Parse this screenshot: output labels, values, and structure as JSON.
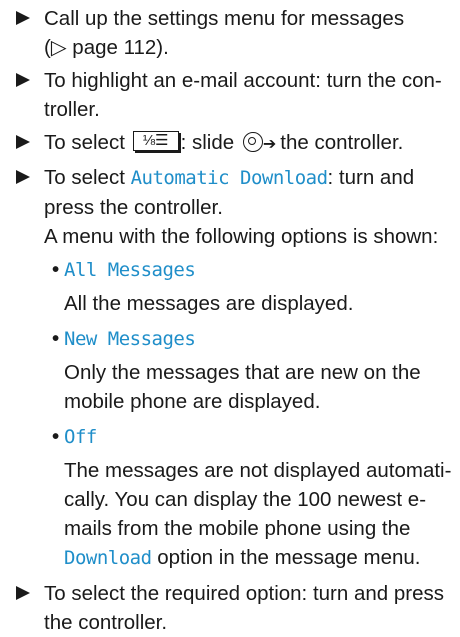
{
  "steps": {
    "s1_line1": "Call up the settings menu for messages",
    "s1_pageref": "(▷ page 112).",
    "s2_text": "To highlight an e-mail account: turn the con-troller.",
    "s3_before": "To select",
    "s3_key_glyph": "⅛☰",
    "s3_mid": ": slide",
    "s3_after": "the controller.",
    "s4_before": "To select",
    "s4_keyword": "Automatic Download",
    "s4_after": ": turn and press the controller.",
    "s4_menu_intro": "A menu with the following options is shown:",
    "s5_text": "To select the required option: turn and press the controller."
  },
  "options": [
    {
      "name": "All Messages",
      "desc": "All the messages are displayed."
    },
    {
      "name": "New Messages",
      "desc": "Only the messages that are new on the mobile phone are displayed."
    },
    {
      "name": "Off",
      "desc_before": "The messages are not displayed automati-cally. You can display the 100 newest e-mails from the mobile phone using the",
      "desc_keyword": "Download",
      "desc_after": "option in the message menu."
    }
  ],
  "icons": {
    "step_bullet": "triangle-right-icon",
    "menu_key": "menu-button-icon",
    "controller_slide": "controller-slide-icon"
  },
  "colors": {
    "keyword": "#1f8ec9",
    "text": "#1a1a1a"
  }
}
